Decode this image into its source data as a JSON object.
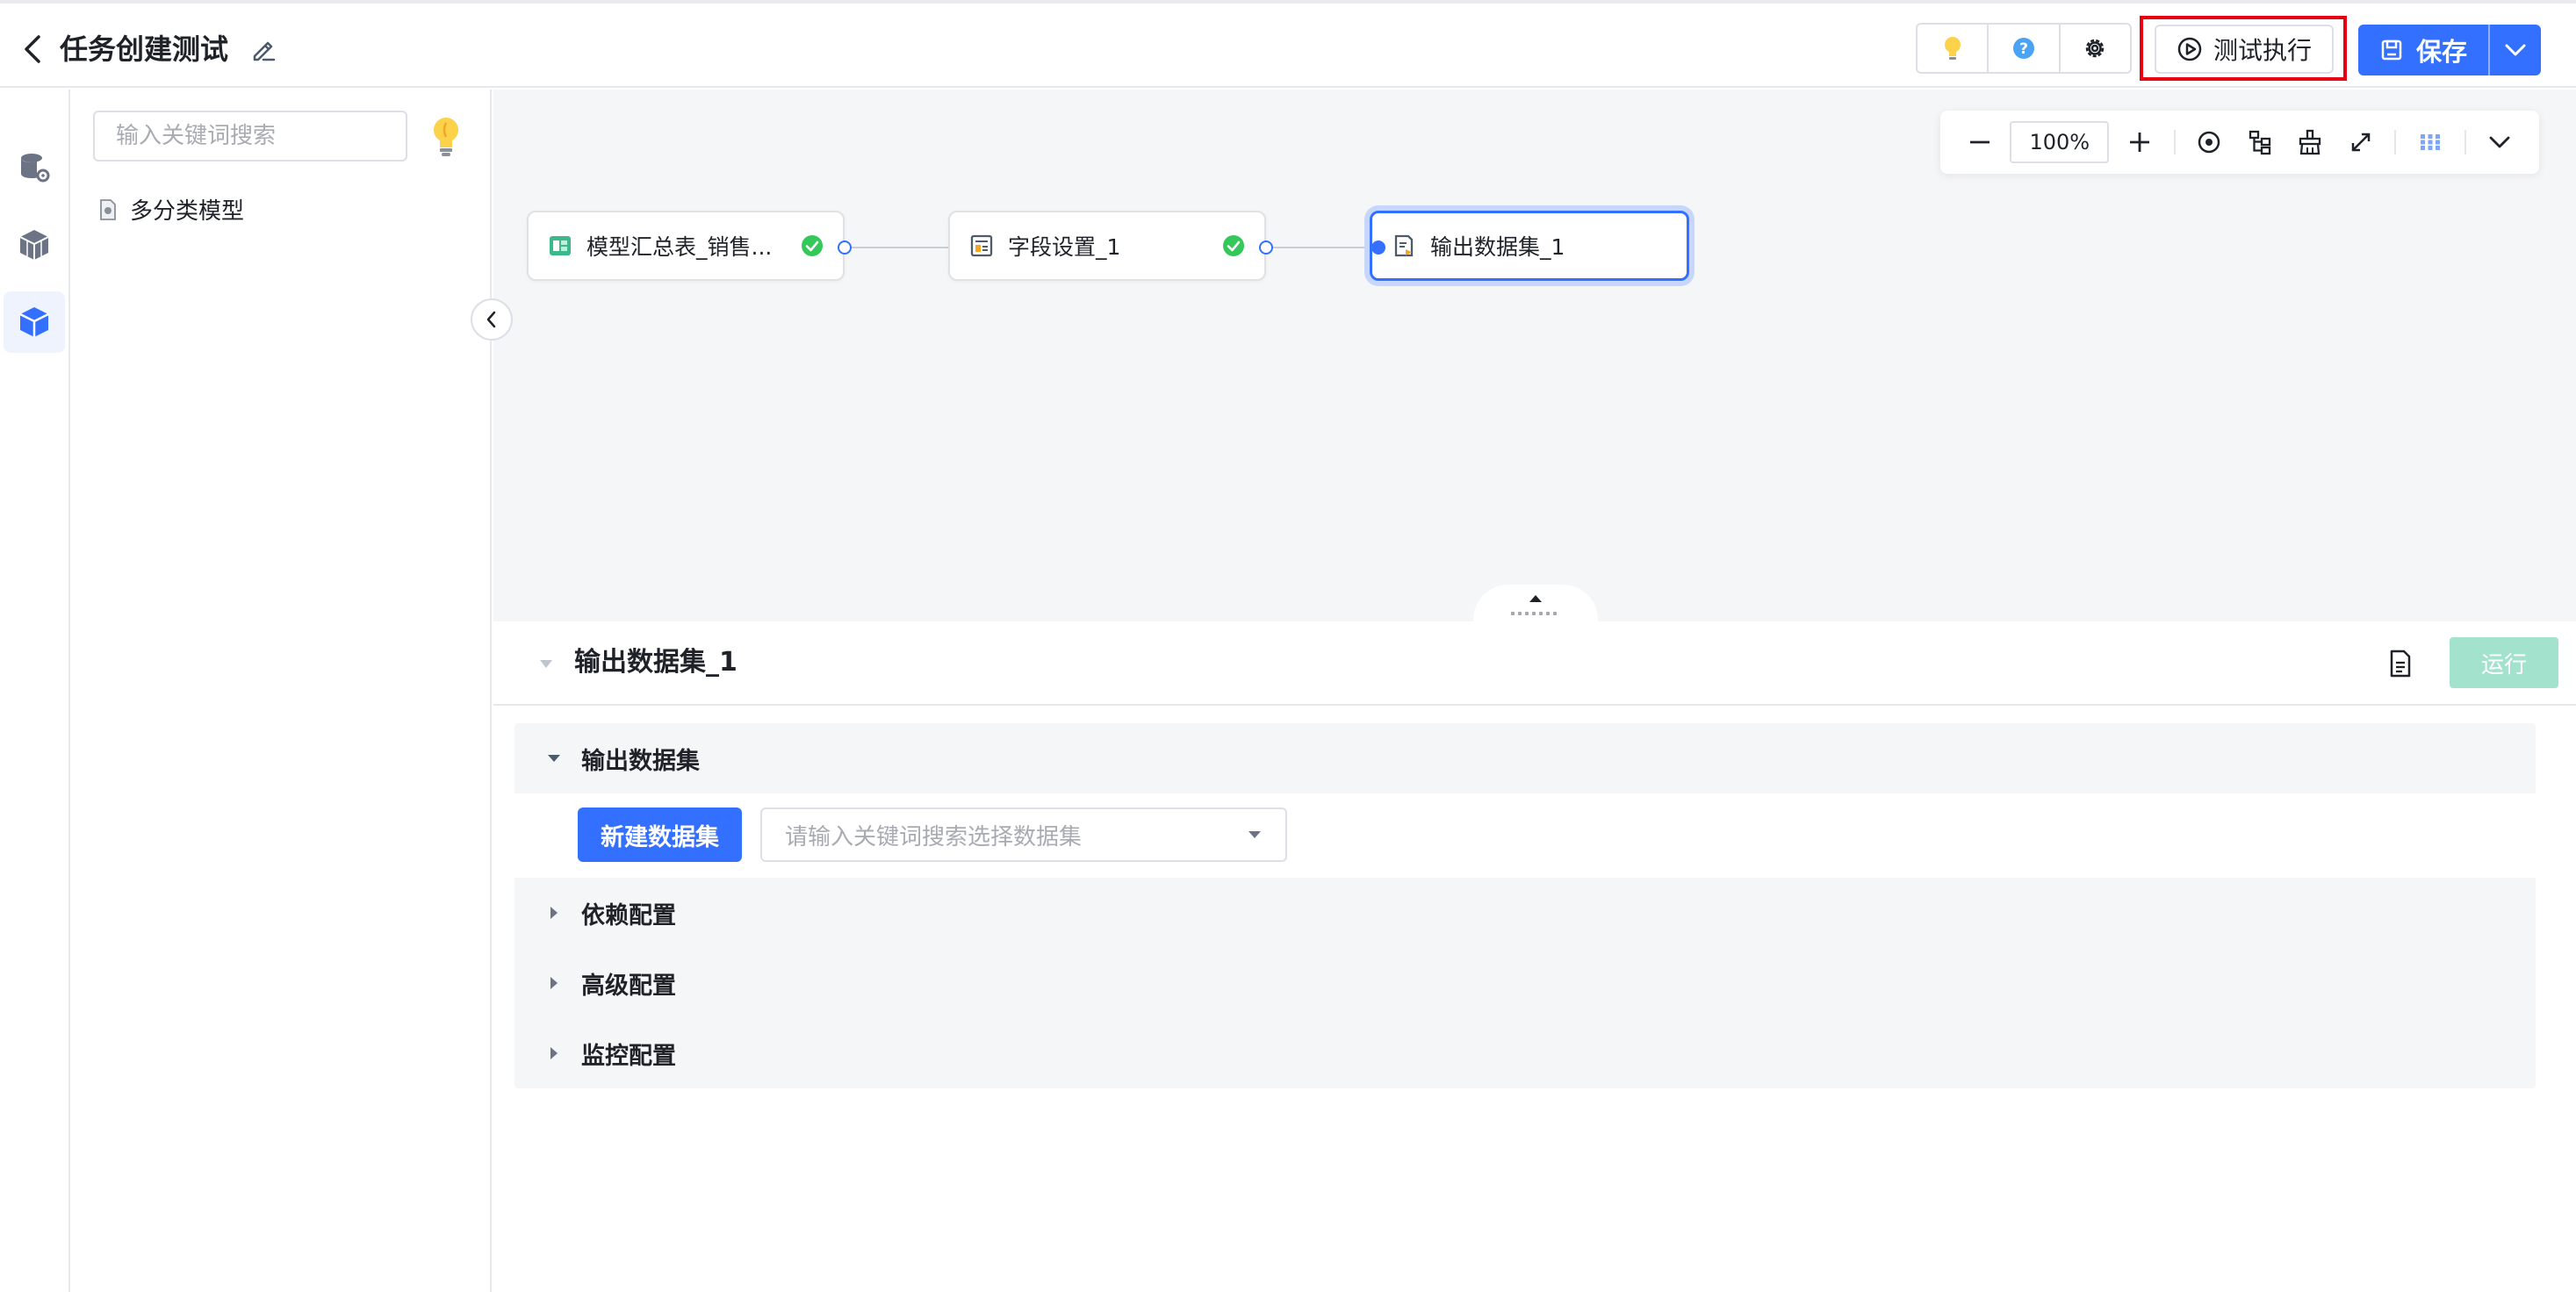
{
  "header": {
    "title": "任务创建测试",
    "test_run_label": "测试执行",
    "save_label": "保存"
  },
  "sidebar": {
    "search_placeholder": "输入关键词搜索",
    "tree": [
      {
        "label": "多分类模型"
      }
    ]
  },
  "canvas": {
    "zoom_value": "100%",
    "nodes": [
      {
        "label": "模型汇总表_销售...",
        "status": "success"
      },
      {
        "label": "字段设置_1",
        "status": "success"
      },
      {
        "label": "输出数据集_1",
        "status": "selected"
      }
    ]
  },
  "panel": {
    "title": "输出数据集_1",
    "run_label": "运行",
    "sections": [
      {
        "label": "输出数据集",
        "expanded": true
      },
      {
        "label": "依赖配置",
        "expanded": false
      },
      {
        "label": "高级配置",
        "expanded": false
      },
      {
        "label": "监控配置",
        "expanded": false
      }
    ],
    "new_dataset_label": "新建数据集",
    "dataset_select_placeholder": "请输入关键词搜索选择数据集"
  },
  "colors": {
    "primary": "#3370ff",
    "success": "#34c759",
    "highlight": "#e60012",
    "run_disabled": "#a3e3cd"
  }
}
